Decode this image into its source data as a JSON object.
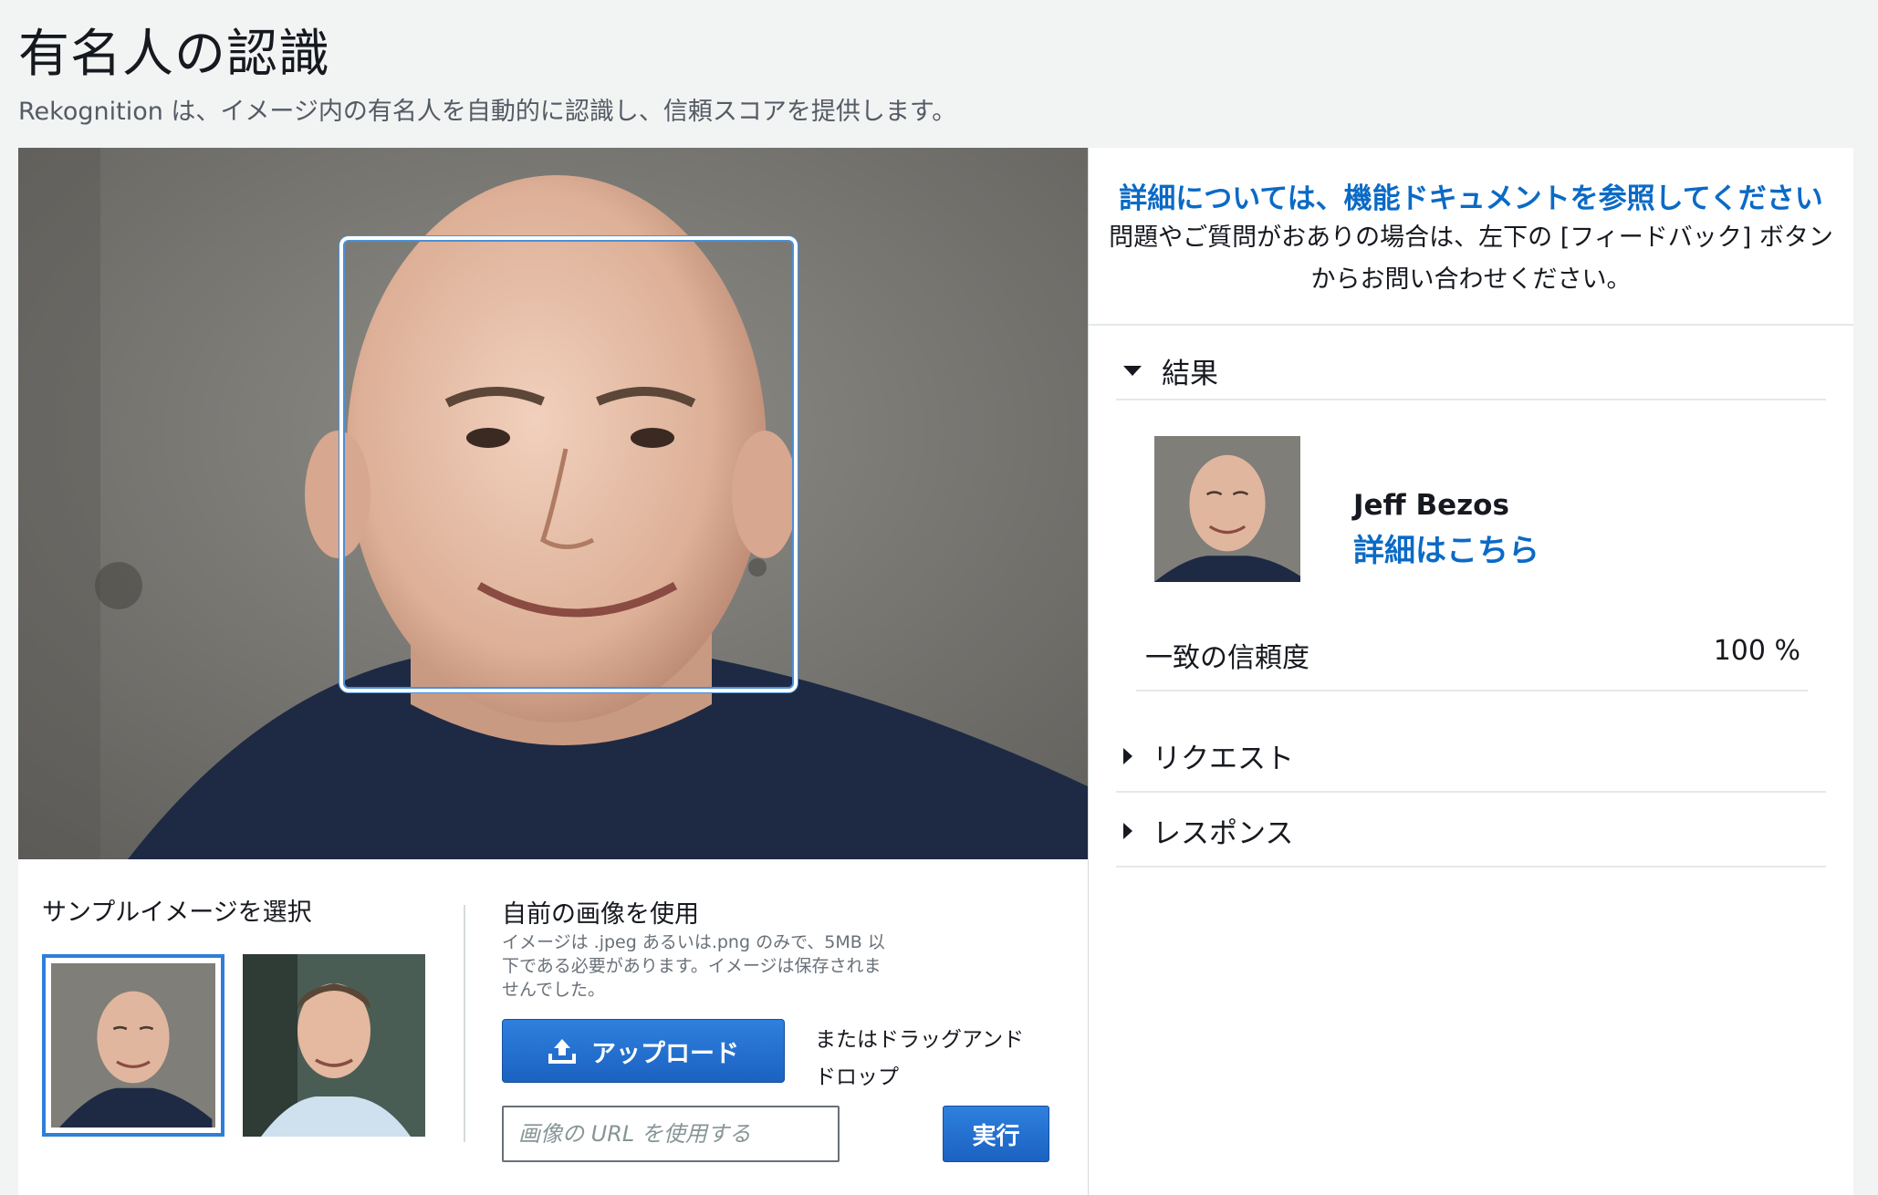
{
  "header": {
    "title": "有名人の認識",
    "description": "Rekognition は、イメージ内の有名人を自動的に認識し、信頼スコアを提供します。"
  },
  "sample": {
    "title": "サンプルイメージを選択"
  },
  "own_image": {
    "title": "自前の画像を使用",
    "note": "イメージは .jpeg あるいは.png のみで、5MB 以下である必要があります。イメージは保存されませんでした。",
    "upload_label": "アップロード",
    "drag_text": "またはドラッグアンド ドロップ",
    "url_placeholder": "画像の URL を使用する",
    "run_label": "実行"
  },
  "info": {
    "doc_link": "詳細については、機能ドキュメントを参照してください",
    "feedback_line1": "問題やご質問がおありの場合は、左下の [フィードバック] ボタン",
    "feedback_line2": "からお問い合わせください。"
  },
  "results": {
    "section_label": "結果",
    "celebrity_name": "Jeff Bezos",
    "details_link": "詳細はこちら",
    "confidence_label": "一致の信頼度",
    "confidence_value": "100 %"
  },
  "request": {
    "section_label": "リクエスト"
  },
  "response": {
    "section_label": "レスポンス"
  },
  "colors": {
    "accent_blue": "#0b6ac6",
    "button_blue": "#1b62c1",
    "bounding_box": "#4a90d9",
    "background": "#f2f3f3"
  }
}
